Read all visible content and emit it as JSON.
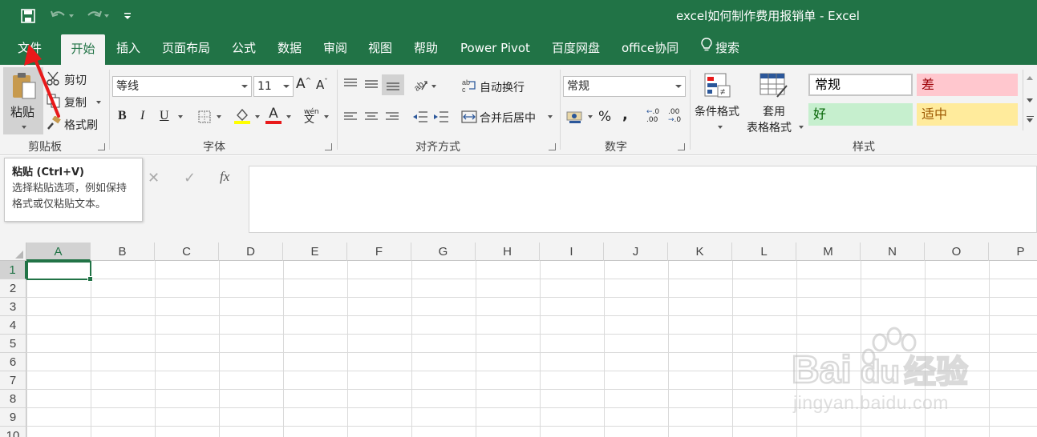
{
  "window": {
    "title": "excel如何制作费用报销单  -  Excel"
  },
  "tabs": [
    {
      "label": "文件"
    },
    {
      "label": "开始"
    },
    {
      "label": "插入"
    },
    {
      "label": "页面布局"
    },
    {
      "label": "公式"
    },
    {
      "label": "数据"
    },
    {
      "label": "审阅"
    },
    {
      "label": "视图"
    },
    {
      "label": "帮助"
    },
    {
      "label": "Power Pivot"
    },
    {
      "label": "百度网盘"
    },
    {
      "label": "office协同"
    },
    {
      "label": "搜索"
    }
  ],
  "ribbon": {
    "clipboard": {
      "label": "剪贴板",
      "paste": "粘贴",
      "cut": "剪切",
      "copy": "复制",
      "format_painter": "格式刷"
    },
    "font": {
      "label": "字体",
      "font_name": "等线",
      "font_size": "11",
      "bold": "B",
      "italic": "I",
      "underline": "U",
      "phonetic": "wén",
      "grow_icon": "A",
      "shrink_icon": "A",
      "font_color_icon": "A"
    },
    "alignment": {
      "label": "对齐方式",
      "wrap_text": "自动换行",
      "merge_center": "合并后居中"
    },
    "number": {
      "label": "数字",
      "format": "常规",
      "percent": "%",
      "comma": ",",
      "inc_decimal": ".00",
      "dec_decimal": ".0"
    },
    "styles": {
      "label": "样式",
      "conditional_format_line1": "条件格式",
      "table_format_line1": "套用",
      "table_format_line2": "表格格式",
      "cells": [
        {
          "label": "常规",
          "bg": "#ffffff",
          "color": "#000000"
        },
        {
          "label": "差",
          "bg": "#ffc7ce",
          "color": "#9c0006"
        },
        {
          "label": "好",
          "bg": "#c6efce",
          "color": "#006100"
        },
        {
          "label": "适中",
          "bg": "#ffeb9c",
          "color": "#9c5700"
        }
      ]
    }
  },
  "tooltip": {
    "title": "粘贴 (Ctrl+V)",
    "body": "选择粘贴选项，例如保持格式或仅粘贴文本。"
  },
  "formula_bar": {
    "cancel": "✕",
    "enter": "✓",
    "fx": "fx"
  },
  "grid": {
    "columns": [
      "A",
      "B",
      "C",
      "D",
      "E",
      "F",
      "G",
      "H",
      "I",
      "J",
      "K",
      "L",
      "M",
      "N",
      "O",
      "P"
    ],
    "rows": [
      "1",
      "2",
      "3",
      "4",
      "5",
      "6",
      "7",
      "8",
      "9",
      "10"
    ],
    "selected_column": "A",
    "selected_row": "1"
  },
  "watermark": {
    "brand": "Baidu经验",
    "url": "jingyan.baidu.com"
  },
  "colors": {
    "accent": "#217346",
    "ribbon_bg": "#f3f3f3",
    "arrow": "#e8191a"
  }
}
